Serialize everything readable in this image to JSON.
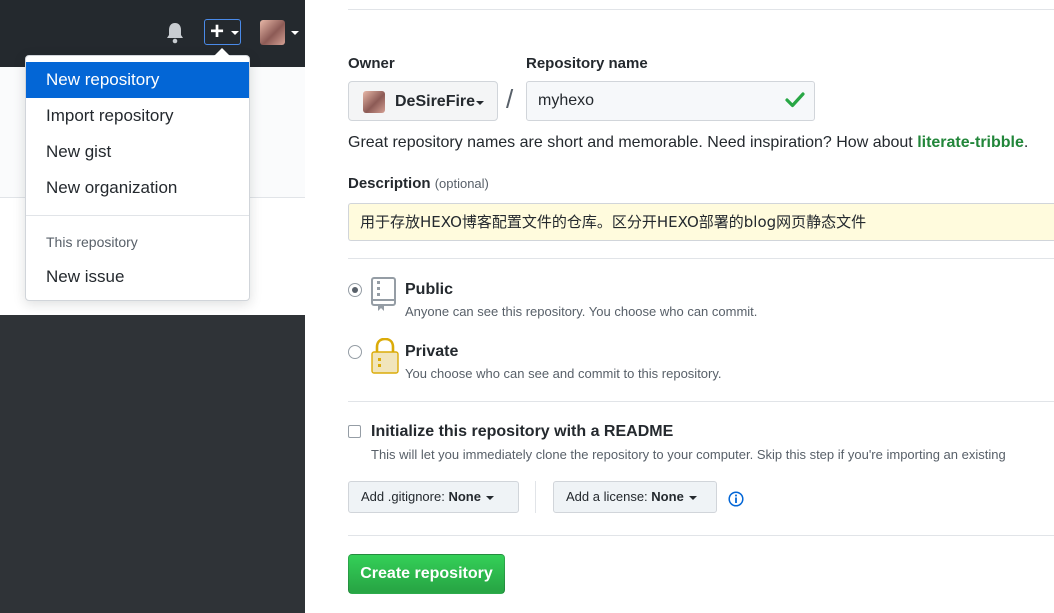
{
  "menu": {
    "items": [
      {
        "label": "New repository"
      },
      {
        "label": "Import repository"
      },
      {
        "label": "New gist"
      },
      {
        "label": "New organization"
      }
    ],
    "section_header": "This repository",
    "section_items": [
      {
        "label": "New issue"
      }
    ]
  },
  "form": {
    "owner_label": "Owner",
    "repo_label": "Repository name",
    "owner_name": "DeSireFire",
    "separator": "/",
    "repo_value": "myhexo",
    "hint_prefix": "Great repository names are short and memorable. Need inspiration? How about ",
    "hint_suggestion": "literate-tribble",
    "hint_suffix": ".",
    "description_label": "Description",
    "description_optional": "(optional)",
    "description_value": "用于存放HEXO博客配置文件的仓库。区分开HEXO部署的blog网页静态文件",
    "public_title": "Public",
    "public_desc": "Anyone can see this repository. You choose who can commit.",
    "private_title": "Private",
    "private_desc": "You choose who can see and commit to this repository.",
    "init_title": "Initialize this repository with a README",
    "init_desc": "This will let you immediately clone the repository to your computer. Skip this step if you're importing an existing",
    "gitignore_label": "Add .gitignore:",
    "gitignore_value": "None",
    "license_label": "Add a license:",
    "license_value": "None",
    "create_label": "Create repository"
  },
  "colors": {
    "accent": "#0366d6",
    "success": "#28a745",
    "header_bg": "#24292e"
  }
}
